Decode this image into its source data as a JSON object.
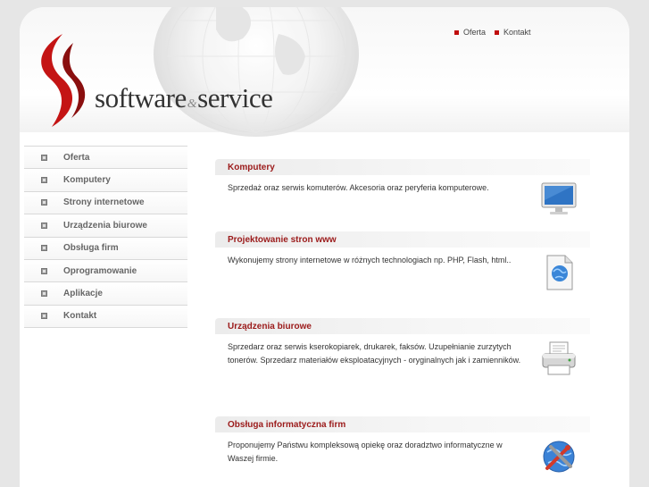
{
  "brand": {
    "name_part1": "software",
    "amp": "&",
    "name_part2": "service"
  },
  "topnav": [
    {
      "label": "Oferta"
    },
    {
      "label": "Kontakt"
    }
  ],
  "sidebar": {
    "items": [
      {
        "label": "Oferta"
      },
      {
        "label": "Komputery"
      },
      {
        "label": "Strony internetowe"
      },
      {
        "label": "Urządzenia biurowe"
      },
      {
        "label": "Obsługa firm"
      },
      {
        "label": "Oprogramowanie"
      },
      {
        "label": "Aplikacje"
      },
      {
        "label": "Kontakt"
      }
    ]
  },
  "sections": [
    {
      "title": "Komputery",
      "text": "Sprzedaż oraz serwis komuterów. Akcesoria oraz peryferia komputerowe.",
      "icon": "monitor-icon"
    },
    {
      "title": "Projektowanie stron www",
      "text": "Wykonujemy strony internetowe w różnych technologiach np. PHP, Flash, html..",
      "icon": "web-document-icon"
    },
    {
      "title": "Urządzenia biurowe",
      "text": "Sprzedarz oraz serwis ksero­kopiarek, drukarek, faksów. Uzupełnianie zurzytych tonerów. Sprzedarz materiałów eksploatacyjnych - oryginalnych jak i zamienników.",
      "icon": "printer-icon"
    },
    {
      "title": "Obsługa informatyczna firm",
      "text": "Proponujemy Państwu kompleksową opiekę oraz doradztwo informatyczne w Waszej firmie.",
      "icon": "support-tools-icon"
    }
  ],
  "colors": {
    "accent": "#c00d0d",
    "heading": "#9b1a1a",
    "page_bg": "#e6e6e6"
  }
}
